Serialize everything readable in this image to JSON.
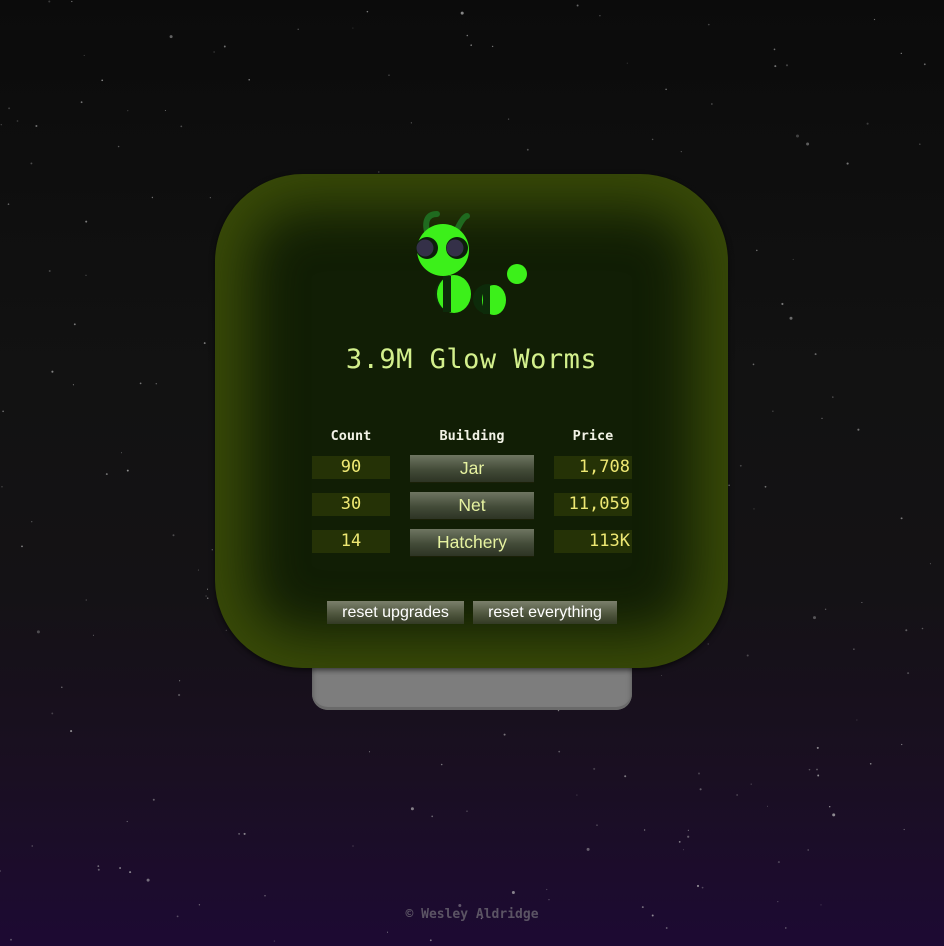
{
  "game": {
    "score_value": "3.9M",
    "score_label": "Glow Worms",
    "accent_color": "#3cf01a",
    "panel_color": "#394a08"
  },
  "table": {
    "headers": {
      "count": "Count",
      "building": "Building",
      "price": "Price"
    },
    "rows": [
      {
        "count": "90",
        "building": "Jar",
        "price": "1,708"
      },
      {
        "count": "30",
        "building": "Net",
        "price": "11,059"
      },
      {
        "count": "14",
        "building": "Hatchery",
        "price": "113K"
      }
    ]
  },
  "actions": {
    "reset_upgrades": "reset upgrades",
    "reset_everything": "reset everything"
  },
  "footer": {
    "copyright": "© Wesley Aldridge"
  },
  "icons": {
    "mascot": "glow-worm-icon"
  }
}
